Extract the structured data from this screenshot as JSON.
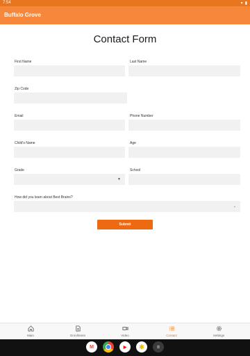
{
  "status_bar": {
    "time": "7:54"
  },
  "app_bar": {
    "title": "Buffalo Grove"
  },
  "form": {
    "title": "Contact Form",
    "fields": {
      "first_name": {
        "label": "First Name",
        "value": ""
      },
      "last_name": {
        "label": "Last Name",
        "value": ""
      },
      "zip_code": {
        "label": "Zip Code",
        "value": ""
      },
      "email": {
        "label": "Email",
        "value": ""
      },
      "phone": {
        "label": "Phone Number",
        "value": ""
      },
      "child_name": {
        "label": "Child's Name",
        "value": ""
      },
      "age": {
        "label": "Age",
        "value": ""
      },
      "grade": {
        "label": "Grade",
        "value": ""
      },
      "school": {
        "label": "School",
        "value": ""
      },
      "referral": {
        "label": "How did you learn about Best Brains?",
        "value": ""
      }
    },
    "submit_label": "Submit"
  },
  "bottom_nav": {
    "items": [
      {
        "label": "Main",
        "icon": "home-icon"
      },
      {
        "label": "Enrollment",
        "icon": "document-icon"
      },
      {
        "label": "Video",
        "icon": "video-icon"
      },
      {
        "label": "Contact",
        "icon": "list-icon",
        "active": true
      },
      {
        "label": "Settings",
        "icon": "gear-icon"
      }
    ]
  },
  "dock": {
    "apps": [
      {
        "name": "gmail-icon",
        "glyph": "M",
        "color": "#ea4335"
      },
      {
        "name": "chrome-icon",
        "glyph": "",
        "color": "#4285f4"
      },
      {
        "name": "youtube-icon",
        "glyph": "▶",
        "color": "#ff0000"
      },
      {
        "name": "photos-icon",
        "glyph": "✱",
        "color": "#fbbc05"
      },
      {
        "name": "app-drawer-icon",
        "glyph": "⋮⋮",
        "color": "#ffffff"
      }
    ]
  },
  "colors": {
    "accent": "#f7873a",
    "submit": "#ee6a12",
    "field_bg": "#f1f1f1"
  }
}
